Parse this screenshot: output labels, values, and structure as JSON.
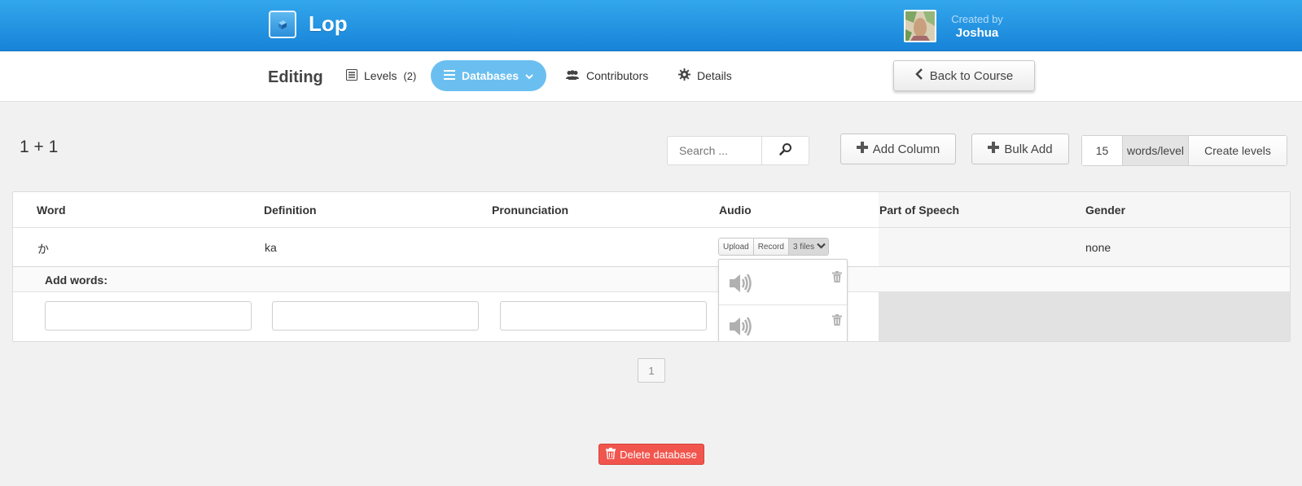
{
  "header": {
    "course_title": "Lop",
    "created_by_label": "Created by",
    "creator_name": "Joshua"
  },
  "edit_nav": {
    "title": "Editing",
    "tabs": [
      {
        "label": "Levels",
        "count": "(2)",
        "icon": "list-icon"
      },
      {
        "label": "Databases",
        "icon": "menu-icon",
        "active": true
      },
      {
        "label": "Contributors",
        "icon": "people-icon"
      },
      {
        "label": "Details",
        "icon": "gear-icon"
      }
    ],
    "back_label": "Back to Course"
  },
  "toolbar": {
    "database_name": "1 + 1",
    "search_placeholder": "Search ...",
    "add_column_label": "Add Column",
    "bulk_add_label": "Bulk Add",
    "words_per_level_value": "15",
    "words_per_level_label": "words/level",
    "create_levels_label": "Create levels"
  },
  "table": {
    "columns": [
      "Word",
      "Definition",
      "Pronunciation",
      "Audio",
      "Part of Speech",
      "Gender"
    ],
    "rows": [
      {
        "word": "か",
        "definition": "ka",
        "pronunciation": "",
        "gender": "none"
      }
    ],
    "audio": {
      "upload_label": "Upload",
      "record_label": "Record",
      "files_label": "3 files"
    },
    "add_words_label": "Add words:"
  },
  "pagination": {
    "current_page": "1"
  },
  "delete_label": "Delete database",
  "colors": {
    "header_blue": "#1883d8",
    "active_tab": "#6bbff0",
    "delete_red": "#f1564e"
  }
}
